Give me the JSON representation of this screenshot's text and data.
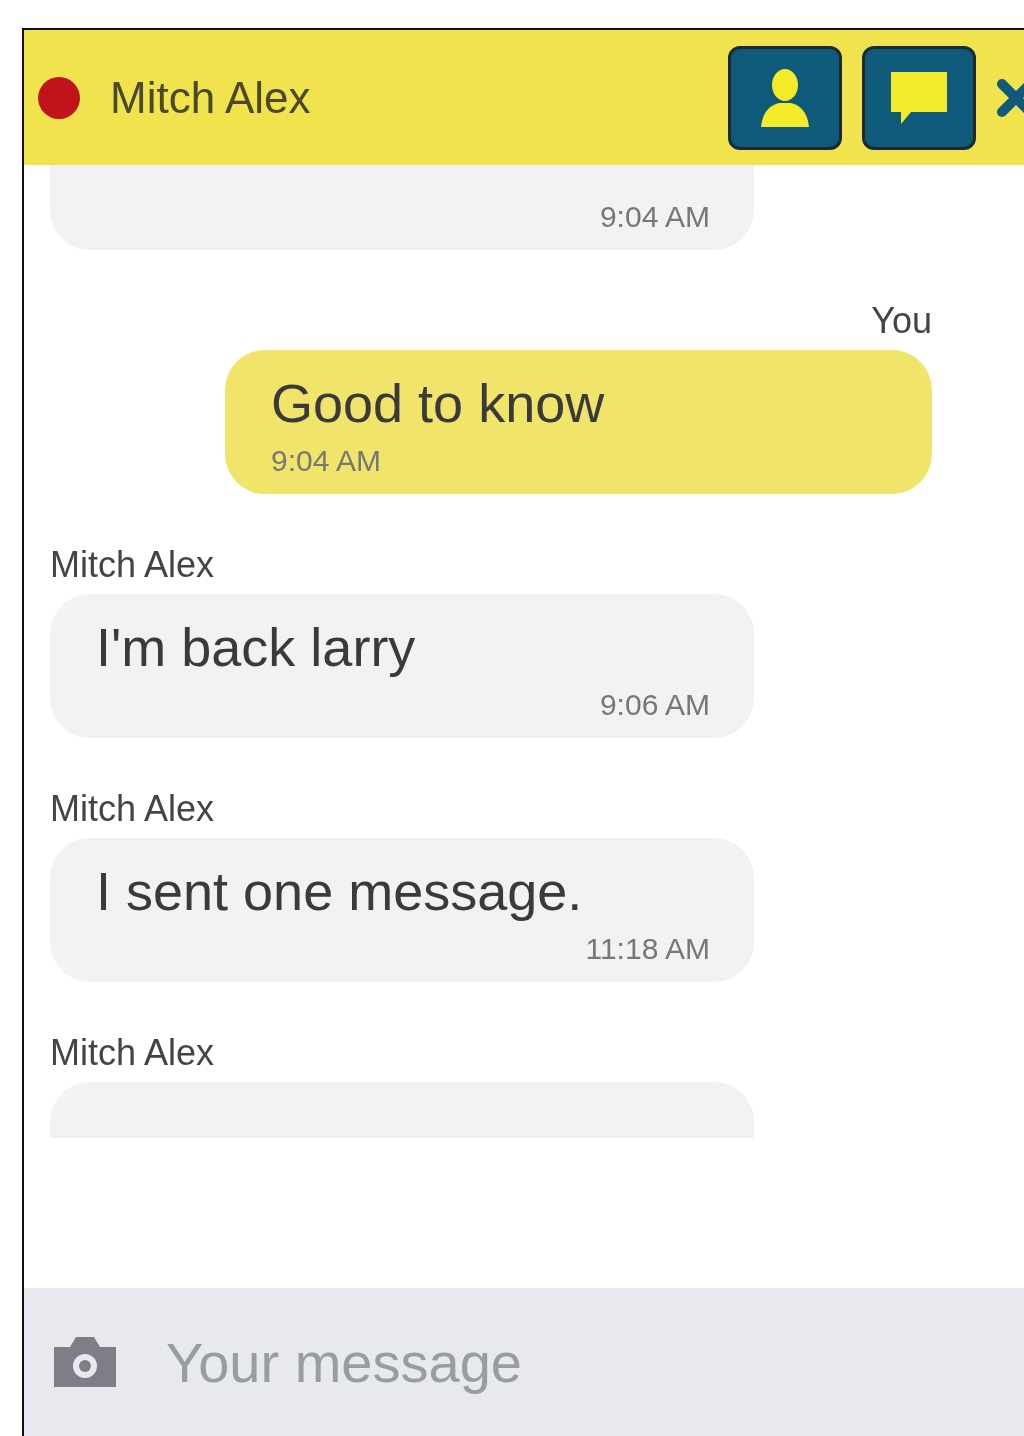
{
  "header": {
    "color": "#c0141a",
    "title": "Mitch Alex"
  },
  "messages": [
    {
      "kind": "incoming",
      "time": "9:04 AM"
    },
    {
      "kind": "outgoing",
      "sender": "You",
      "text": "Good to know",
      "time": "9:04 AM"
    },
    {
      "kind": "incoming",
      "sender": "Mitch Alex",
      "text": "I'm back larry",
      "time": "9:06 AM"
    },
    {
      "kind": "incoming",
      "sender": "Mitch Alex",
      "text": "I sent one message.",
      "time": "11:18 AM"
    },
    {
      "kind": "incoming",
      "sender": "Mitch Alex"
    }
  ],
  "composer": {
    "placeholder": "Your message"
  }
}
